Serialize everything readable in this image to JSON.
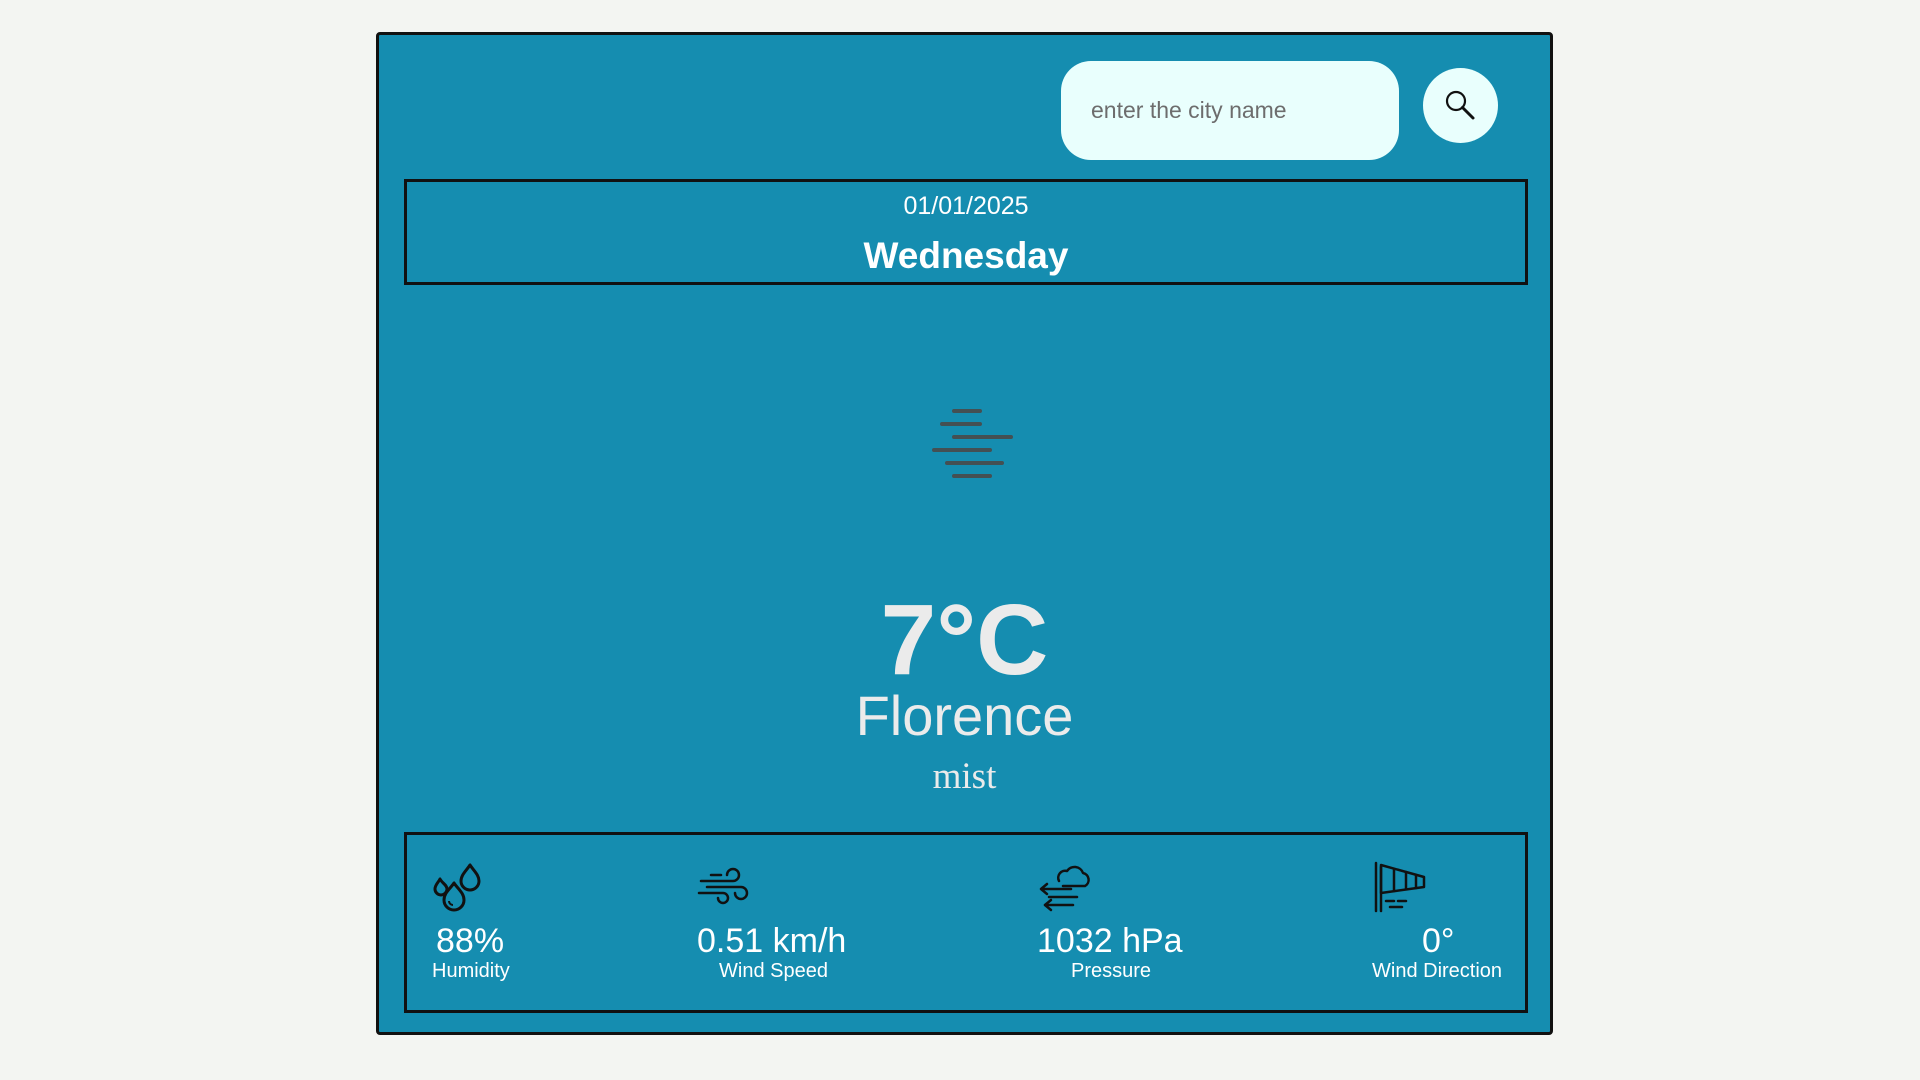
{
  "search": {
    "placeholder": "enter the city name",
    "button_icon": "search-icon"
  },
  "date": {
    "date_text": "01/01/2025",
    "day": "Wednesday"
  },
  "current": {
    "icon": "mist-icon",
    "temperature": "7°C",
    "city": "Florence",
    "description": "mist"
  },
  "stats": [
    {
      "icon": "humidity-icon",
      "value": "88%",
      "label": "Humidity"
    },
    {
      "icon": "wind-icon",
      "value": "0.51 km/h",
      "label": "Wind Speed"
    },
    {
      "icon": "pressure-icon",
      "value": "1032 hPa",
      "label": "Pressure"
    },
    {
      "icon": "windsock-icon",
      "value": "0°",
      "label": "Wind Direction"
    }
  ],
  "colors": {
    "page_background": "#f3f5f2",
    "card_background": "#158db0",
    "input_background": "#e9fffd",
    "border": "#111111",
    "text_light": "#ebebeb"
  }
}
